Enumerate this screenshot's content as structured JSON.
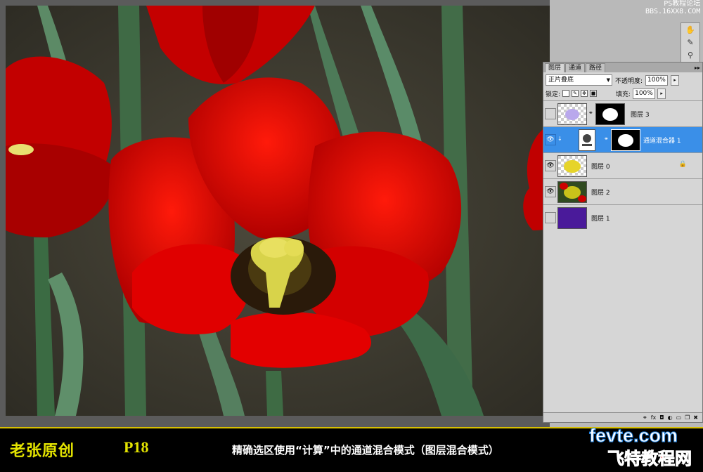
{
  "watermark": {
    "line1": "PS教程论坛",
    "line2": "BBS.16XX8.COM"
  },
  "tools": {
    "icons": [
      "hand-tool-icon",
      "brush-tool-icon",
      "clone-tool-icon"
    ]
  },
  "layers_panel": {
    "tabs": [
      {
        "label": "图层",
        "active": true
      },
      {
        "label": "通道",
        "active": false
      },
      {
        "label": "路径",
        "active": false
      }
    ],
    "menu_symbol": "▸▸",
    "blend_mode": "正片叠底",
    "opacity_label": "不透明度:",
    "opacity_value": "100%",
    "lock_label": "锁定:",
    "fill_label": "填充:",
    "fill_value": "100%",
    "layers": [
      {
        "name": "图层 3",
        "visible": false,
        "selected": false,
        "thumb": "lavender",
        "has_mask": true,
        "locked": false
      },
      {
        "name": "通道混合器 1",
        "visible": true,
        "selected": true,
        "thumb": "adjustment",
        "has_mask": true,
        "locked": false
      },
      {
        "name": "图层 0",
        "visible": true,
        "selected": false,
        "thumb": "yellow-flower",
        "has_mask": false,
        "locked": true
      },
      {
        "name": "图层 2",
        "visible": true,
        "selected": false,
        "thumb": "flower-dark",
        "has_mask": false,
        "locked": false
      },
      {
        "name": "图层 1",
        "visible": false,
        "selected": false,
        "thumb": "purple",
        "has_mask": false,
        "locked": false
      }
    ],
    "bottom_icons": [
      "link-icon",
      "fx-icon",
      "mask-icon",
      "adjustment-icon",
      "group-icon",
      "new-layer-icon",
      "trash-icon"
    ],
    "bottom_glyphs": [
      "⚭",
      "fx",
      "◘",
      "◐",
      "▭",
      "❐",
      "✖"
    ]
  },
  "caption": {
    "author": "老张原创",
    "page": "P18",
    "description": "精确选区使用“计算”中的通道混合模式（图层混合模式）"
  },
  "logo": {
    "line1": "fevte.com",
    "line2": "飞特教程网"
  },
  "colors": {
    "caption_yellow": "#e4e400",
    "selection_blue": "#3a8fe8",
    "flower_red": "#d40000"
  }
}
